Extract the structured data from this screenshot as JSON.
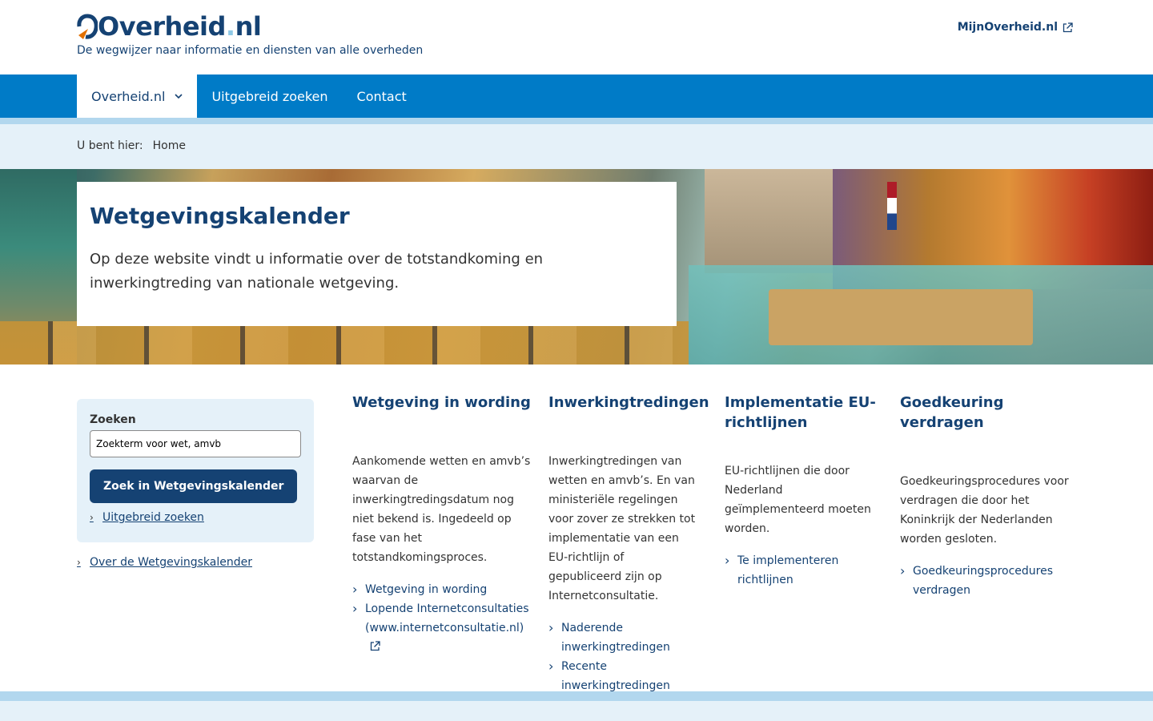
{
  "header": {
    "logo_main": "Overheid",
    "logo_dot": ".",
    "logo_tld": "nl",
    "tagline": "De wegwijzer naar informatie en diensten van alle overheden",
    "mijn_link": "MijnOverheid.nl"
  },
  "nav": {
    "items": [
      {
        "label": "Overheid.nl"
      },
      {
        "label": "Uitgebreid zoeken"
      },
      {
        "label": "Contact"
      }
    ]
  },
  "breadcrumb": {
    "prefix": "U bent hier:",
    "current": "Home"
  },
  "hero": {
    "title": "Wetgevingskalender",
    "text": "Op deze website vindt u informatie over de totstandkoming en inwerkingtreding van nationale wetgeving."
  },
  "search": {
    "label": "Zoeken",
    "value": "Zoekterm voor wet, amvb",
    "button": "Zoek in Wetgevingskalender",
    "advanced_link": "Uitgebreid zoeken"
  },
  "about_link": "Over de Wetgevingskalender",
  "columns": [
    {
      "title": "Wetgeving in wording",
      "text": "Aankomende wetten en amvb’s waarvan de inwerkingtredingsdatum nog niet bekend is. Ingedeeld op fase van het totstandkomingsproces.",
      "links": [
        "Wetgeving in wording",
        "Lopende Internetconsultaties (www.internetconsultatie.nl)"
      ]
    },
    {
      "title": "Inwerkingtredingen",
      "text": "Inwerkingtredingen van wetten en amvb’s. En van ministeriële regelingen voor zover ze strekken tot implementatie van een EU-richtlijn of gepubliceerd zijn op Internetconsultatie.",
      "links": [
        "Naderende inwerkingtredingen",
        "Recente inwerkingtredingen"
      ]
    },
    {
      "title": "Implementatie EU-richtlijnen",
      "text": "EU-richtlijnen die door Nederland geïmplementeerd moeten worden.",
      "links": [
        "Te implementeren richtlijnen"
      ]
    },
    {
      "title": "Goedkeuring verdragen",
      "text": "Goedkeuringsprocedures voor verdragen die door het Koninkrijk der Nederlanden worden gesloten.",
      "links": [
        "Goedkeuringsprocedures verdragen"
      ]
    }
  ],
  "colors": {
    "brand_dark": "#154273",
    "nav_blue": "#007bc7",
    "light_blue": "#e5f1f9",
    "logo_accent": "#e17000"
  },
  "icons": [
    "logo-mark-icon",
    "external-link-icon",
    "chevron-down-icon",
    "chevron-right-icon"
  ]
}
